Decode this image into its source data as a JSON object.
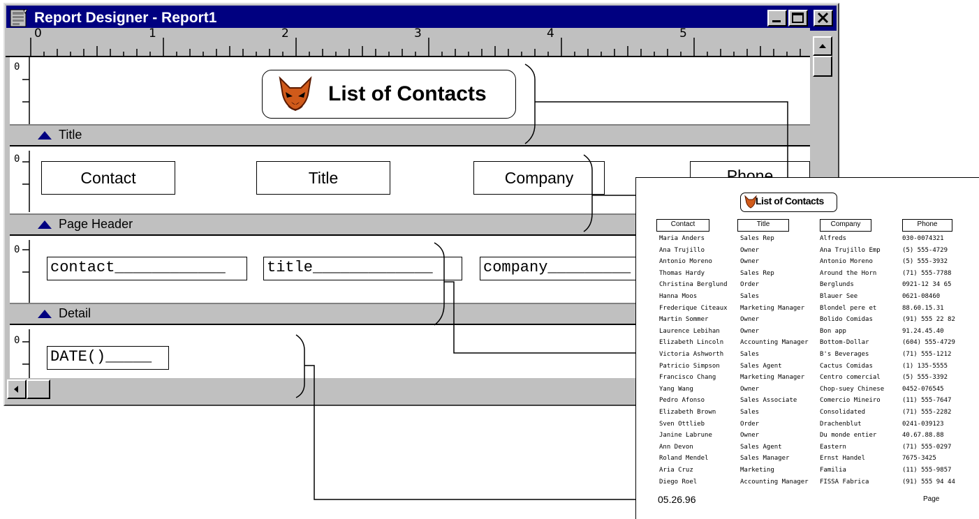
{
  "window": {
    "title": "Report Designer - Report1"
  },
  "ruler": {
    "marks": [
      "0",
      "1",
      "2",
      "3",
      "4",
      "5"
    ]
  },
  "band_rows_start": "0",
  "bands": {
    "title": "Title",
    "page_header": "Page Header",
    "detail": "Detail"
  },
  "title_band": {
    "report_title": "List of Contacts"
  },
  "page_header_fields": [
    "Contact",
    "Title",
    "Company",
    "Phone"
  ],
  "detail_fields": [
    "contact",
    "title",
    "company"
  ],
  "footer_fields": [
    "DATE()"
  ],
  "preview": {
    "title": "List of Contacts",
    "headers": [
      "Contact",
      "Title",
      "Company",
      "Phone"
    ],
    "rows": [
      [
        "Maria Anders",
        "Sales Rep",
        "Alfreds",
        "030-0074321"
      ],
      [
        "Ana Trujillo",
        "Owner",
        "Ana Trujillo Emp",
        "(5) 555-4729"
      ],
      [
        "Antonio Moreno",
        "Owner",
        "Antonio Moreno",
        "(5) 555-3932"
      ],
      [
        "Thomas Hardy",
        "Sales Rep",
        "Around the Horn",
        "(71) 555-7788"
      ],
      [
        "Christina Berglund",
        "Order",
        "Berglunds",
        "0921-12 34 65"
      ],
      [
        "Hanna Moos",
        "Sales",
        "Blauer See",
        "0621-08460"
      ],
      [
        "Frederique Citeaux",
        "Marketing Manager",
        "Blondel pere et",
        "88.60.15.31"
      ],
      [
        "Martin Sommer",
        "Owner",
        "Bolido Comidas",
        "(91) 555 22 82"
      ],
      [
        "Laurence Lebihan",
        "Owner",
        "Bon app",
        "91.24.45.40"
      ],
      [
        "Elizabeth Lincoln",
        "Accounting Manager",
        "Bottom-Dollar",
        "(604) 555-4729"
      ],
      [
        "Victoria Ashworth",
        "Sales",
        "B's Beverages",
        "(71) 555-1212"
      ],
      [
        "Patricio Simpson",
        "Sales Agent",
        "Cactus Comidas",
        "(1) 135-5555"
      ],
      [
        "Francisco Chang",
        "Marketing Manager",
        "Centro comercial",
        "(5) 555-3392"
      ],
      [
        "Yang Wang",
        "Owner",
        "Chop-suey Chinese",
        "0452-076545"
      ],
      [
        "Pedro Afonso",
        "Sales Associate",
        "Comercio Mineiro",
        "(11) 555-7647"
      ],
      [
        "Elizabeth Brown",
        "Sales",
        "Consolidated",
        "(71) 555-2282"
      ],
      [
        "Sven Ottlieb",
        "Order",
        "Drachenblut",
        "0241-039123"
      ],
      [
        "Janine Labrune",
        "Owner",
        "Du monde entier",
        "40.67.88.88"
      ],
      [
        "Ann Devon",
        "Sales Agent",
        "Eastern",
        "(71) 555-0297"
      ],
      [
        "Roland Mendel",
        "Sales Manager",
        "Ernst Handel",
        "7675-3425"
      ],
      [
        "Aria Cruz",
        "Marketing",
        "Familia",
        "(11) 555-9857"
      ],
      [
        "Diego Roel",
        "Accounting Manager",
        "FISSA Fabrica",
        "(91) 555 94 44"
      ]
    ],
    "date": "05.26.96",
    "page": "Page"
  },
  "colors": {
    "titlebar": "#000080",
    "chrome": "#c0c0c0",
    "band_triangle": "#000080"
  }
}
